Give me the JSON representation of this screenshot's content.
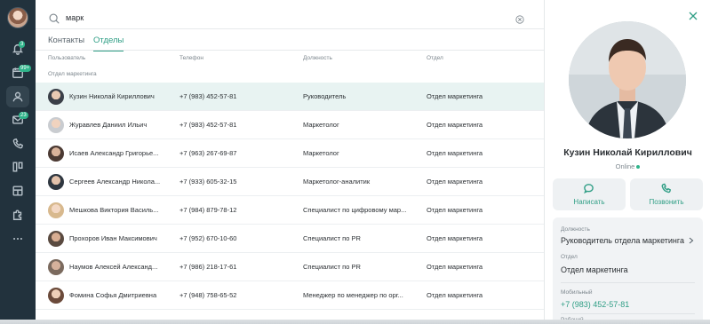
{
  "search": {
    "query": "марк"
  },
  "tabs": [
    "Контакты",
    "Отделы"
  ],
  "columns": {
    "user": "Пользователь",
    "phone": "Телефон",
    "position": "Должность",
    "department": "Отдел"
  },
  "section_title": "Отдел маркетинга",
  "rail": {
    "badges": [
      "3",
      "99+",
      "23"
    ]
  },
  "rows": [
    {
      "name": "Кузин Николай Кириллович",
      "phone": "+7 (983) 452-57-81",
      "position": "Руководитель",
      "department": "Отдел маркетинга"
    },
    {
      "name": "Журавлев Даниил Ильич",
      "phone": "+7 (983) 452-57-81",
      "position": "Маркетолог",
      "department": "Отдел маркетинга"
    },
    {
      "name": "Исаев Александр Григорье...",
      "phone": "+7 (963) 267-69-87",
      "position": "Маркетолог",
      "department": "Отдел маркетинга"
    },
    {
      "name": "Сергеев Александр Никола...",
      "phone": "+7 (933) 605-32-15",
      "position": "Маркетолог-аналитик",
      "department": "Отдел маркетинга"
    },
    {
      "name": "Мешкова Виктория Василь...",
      "phone": "+7 (984) 879-78-12",
      "position": "Специалист по цифровому мар...",
      "department": "Отдел маркетинга"
    },
    {
      "name": "Прохоров Иван Максимович",
      "phone": "+7 (952) 670-10-60",
      "position": "Специалист по PR",
      "department": "Отдел маркетинга"
    },
    {
      "name": "Наумов Алексей Александ...",
      "phone": "+7 (986) 218-17-61",
      "position": "Специалист по PR",
      "department": "Отдел маркетинга"
    },
    {
      "name": "Фомина Софья Дмитриевна",
      "phone": "+7 (948) 758-65-52",
      "position": "Менеджер по менеджер по орг...",
      "department": "Отдел маркетинга"
    }
  ],
  "profile": {
    "name": "Кузин Николай Кириллович",
    "status": "Online",
    "write_label": "Написать",
    "call_label": "Позвонить",
    "position_key": "Должность",
    "position_value": "Руководитель отдела маркетинга",
    "department_key": "Отдел",
    "department_value": "Отдел маркетинга",
    "mobile_key": "Мобильный",
    "mobile_value": "+7 (983) 452-57-81",
    "work_key": "Рабочий"
  },
  "colors": {
    "accent": "#2f9e85",
    "rail": "#22323d",
    "selected_row": "#e8f3f2",
    "badge": "#2fb48a"
  }
}
